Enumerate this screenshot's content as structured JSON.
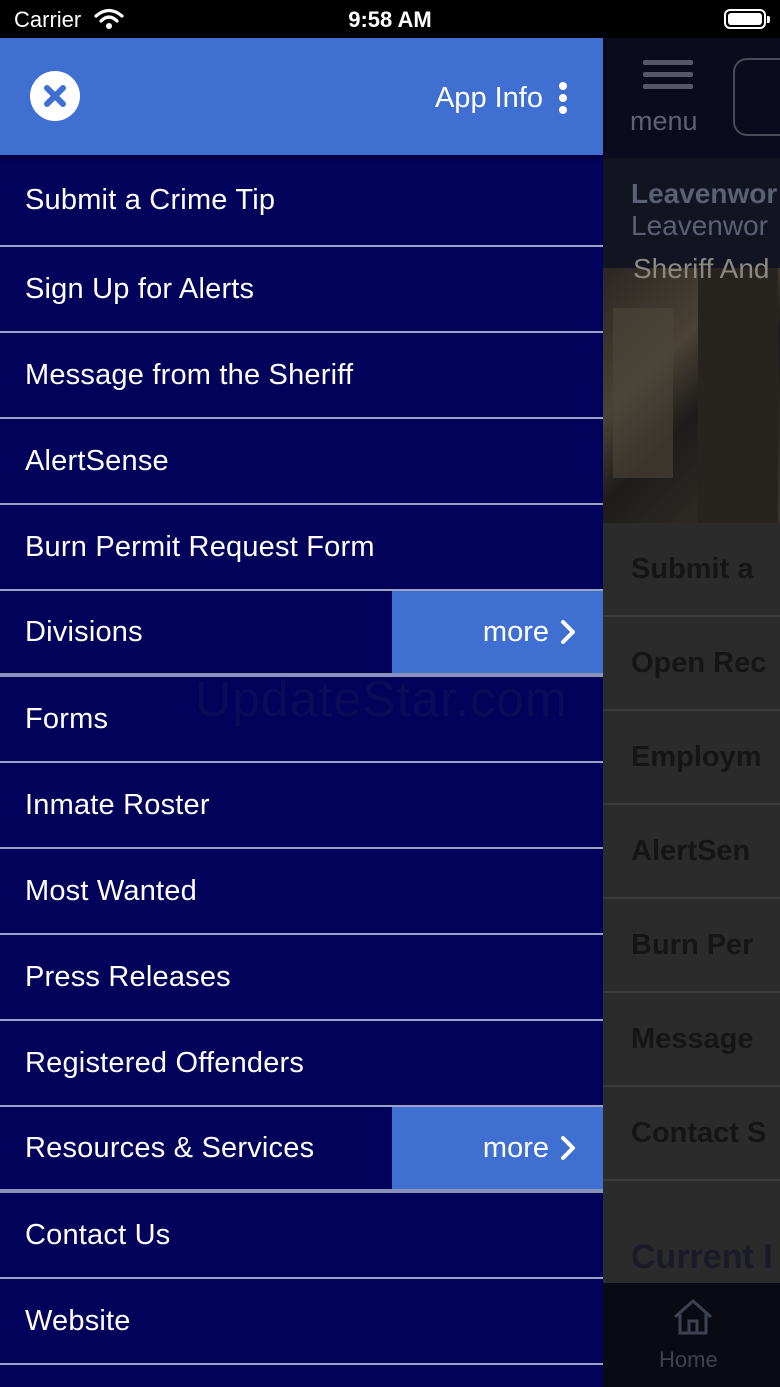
{
  "status_bar": {
    "carrier": "Carrier",
    "time": "9:58 AM"
  },
  "drawer": {
    "header": {
      "app_info_label": "App Info"
    },
    "items": [
      {
        "label": "Submit a Crime Tip"
      },
      {
        "label": "Sign Up for Alerts"
      },
      {
        "label": "Message from the Sheriff"
      },
      {
        "label": "AlertSense"
      },
      {
        "label": "Burn Permit Request Form"
      },
      {
        "label": "Divisions",
        "more": "more"
      },
      {
        "label": "Forms"
      },
      {
        "label": "Inmate Roster"
      },
      {
        "label": "Most Wanted"
      },
      {
        "label": "Press Releases"
      },
      {
        "label": "Registered Offenders"
      },
      {
        "label": "Resources & Services",
        "more": "more"
      },
      {
        "label": "Contact Us"
      },
      {
        "label": "Website"
      }
    ]
  },
  "background_app": {
    "menu_label": "menu",
    "title_line1": "Leavenwor",
    "title_line2": "Leavenwor",
    "hero_caption": "Sheriff And",
    "list": [
      "Submit a",
      "Open Rec",
      "Employm",
      "AlertSen",
      "Burn Per",
      "Message",
      "Contact S"
    ],
    "current_heading": "Current I",
    "tab_home": "Home"
  },
  "watermark": "UpdateStar.com",
  "colors": {
    "drawer_bg": "#02025a",
    "header_bg": "#3f6fd0",
    "more_bg": "#3f6fd0",
    "divider": "#9aa1c2"
  },
  "icons": {
    "close": "close-circle-icon",
    "app_info_menu": "kebab-icon",
    "more": "chevron-right-icon",
    "bg_menu": "hamburger-icon",
    "bg_home": "home-icon"
  }
}
